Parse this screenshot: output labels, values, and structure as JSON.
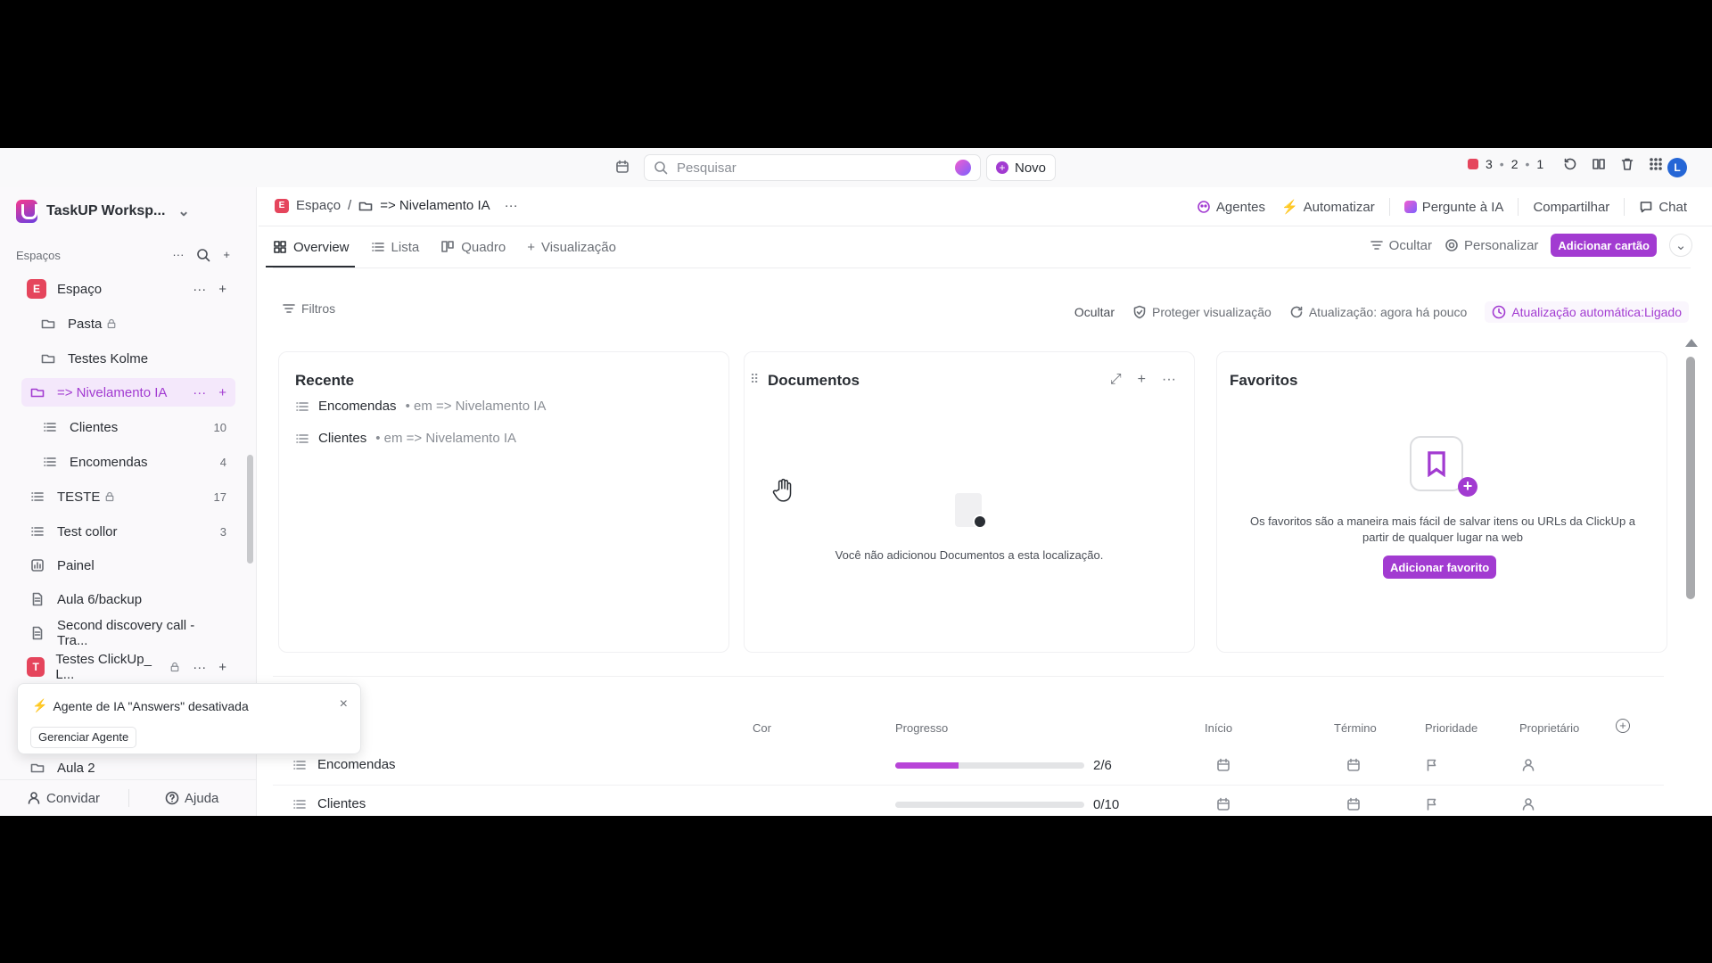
{
  "topbar": {
    "search_placeholder": "Pesquisar",
    "new_label": "Novo",
    "recording": {
      "a": "3",
      "b": "2",
      "c": "1"
    },
    "avatar_initial": "L"
  },
  "sidebar": {
    "workspace": "TaskUP Worksp...",
    "spaces_label": "Espaços",
    "items": [
      {
        "label": "Espaço",
        "badge": "E",
        "badge_color": "#e5455c"
      },
      {
        "label": "Pasta"
      },
      {
        "label": "Testes Kolme"
      },
      {
        "label": "=> Nivelamento IA"
      },
      {
        "label": "Clientes",
        "count": "10"
      },
      {
        "label": "Encomendas",
        "count": "4"
      },
      {
        "label": "TESTE",
        "count": "17"
      },
      {
        "label": "Test collor",
        "count": "3"
      },
      {
        "label": "Painel"
      },
      {
        "label": "Aula 6/backup"
      },
      {
        "label": "Second discovery call - Tra..."
      },
      {
        "label": "Testes ClickUp_ L...",
        "badge": "T",
        "badge_color": "#e5455c"
      },
      {
        "label": "Aula 2"
      }
    ],
    "toast": {
      "title": "Agente de IA \"Answers\" desativada",
      "button": "Gerenciar Agente"
    },
    "footer": {
      "invite": "Convidar",
      "help": "Ajuda"
    }
  },
  "header": {
    "breadcrumb": {
      "space": "Espaço",
      "space_badge": "E",
      "sep": "/",
      "current": "=> Nivelamento IA"
    },
    "actions": {
      "agents": "Agentes",
      "automate": "Automatizar",
      "ask_ai": "Pergunte à IA",
      "share": "Compartilhar",
      "chat": "Chat"
    }
  },
  "tabs": [
    {
      "label": "Overview",
      "active": true
    },
    {
      "label": "Lista"
    },
    {
      "label": "Quadro"
    },
    {
      "label": "Visualização"
    }
  ],
  "tabs_right": {
    "hide": "Ocultar",
    "customize": "Personalizar",
    "add_card": "Adicionar cartão"
  },
  "filterbar": {
    "filters": "Filtros",
    "hide": "Ocultar",
    "protect": "Proteger visualização",
    "updated": "Atualização: agora há pouco",
    "auto": "Atualização automática:Ligado"
  },
  "cards": {
    "recent": {
      "title": "Recente",
      "items": [
        {
          "name": "Encomendas",
          "location": "• em => Nivelamento IA"
        },
        {
          "name": "Clientes",
          "location": "• em => Nivelamento IA"
        }
      ]
    },
    "docs": {
      "title": "Documentos",
      "empty": "Você não adicionou Documentos a esta localização."
    },
    "favorites": {
      "title": "Favoritos",
      "empty": "Os favoritos são a maneira mais fácil de salvar itens ou URLs da ClickUp a partir de qualquer lugar na web",
      "button": "Adicionar favorito"
    }
  },
  "table": {
    "columns": {
      "color": "Cor",
      "progress": "Progresso",
      "start": "Início",
      "end": "Término",
      "priority": "Prioridade",
      "owner": "Proprietário"
    },
    "rows": [
      {
        "name": "Encomendas",
        "progress_text": "2/6",
        "progress": 0.333
      },
      {
        "name": "Clientes",
        "progress_text": "0/10",
        "progress": 0
      }
    ]
  },
  "colors": {
    "accent": "#a23bd1",
    "space": "#e5455c"
  }
}
